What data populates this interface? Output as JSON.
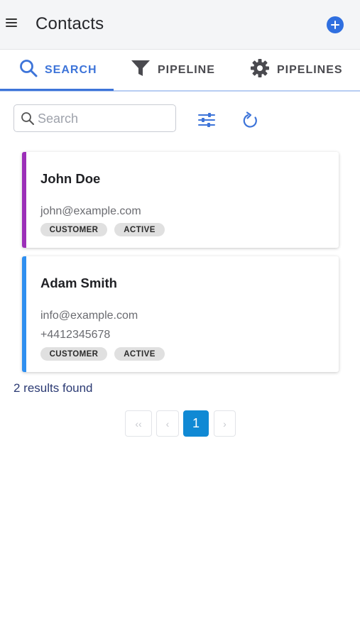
{
  "header": {
    "title": "Contacts",
    "menu_icon": "hamburger-menu-icon",
    "add_icon": "add-circle-icon"
  },
  "tabs": [
    {
      "label": "SEARCH",
      "icon": "search-icon",
      "active": true
    },
    {
      "label": "PIPELINE",
      "icon": "funnel-icon",
      "active": false
    },
    {
      "label": "PIPELINES",
      "icon": "gear-icon",
      "active": false
    }
  ],
  "search": {
    "placeholder": "Search",
    "value": "",
    "filter_icon": "sliders-icon",
    "refresh_icon": "refresh-icon"
  },
  "contacts": [
    {
      "name": "John Doe",
      "email": "john@example.com",
      "phone": "",
      "tags": [
        "CUSTOMER",
        "ACTIVE"
      ],
      "accent_color": "#9c2fb8"
    },
    {
      "name": "Adam Smith",
      "email": "info@example.com",
      "phone": "+4412345678",
      "tags": [
        "CUSTOMER",
        "ACTIVE"
      ],
      "accent_color": "#2f8ff0"
    }
  ],
  "results_text": "2 results found",
  "pagination": {
    "first_label": "‹‹",
    "prev_label": "‹",
    "current_page": "1",
    "next_label": "›"
  },
  "colors": {
    "accent": "#3d74d9",
    "page_active": "#1089d4"
  }
}
